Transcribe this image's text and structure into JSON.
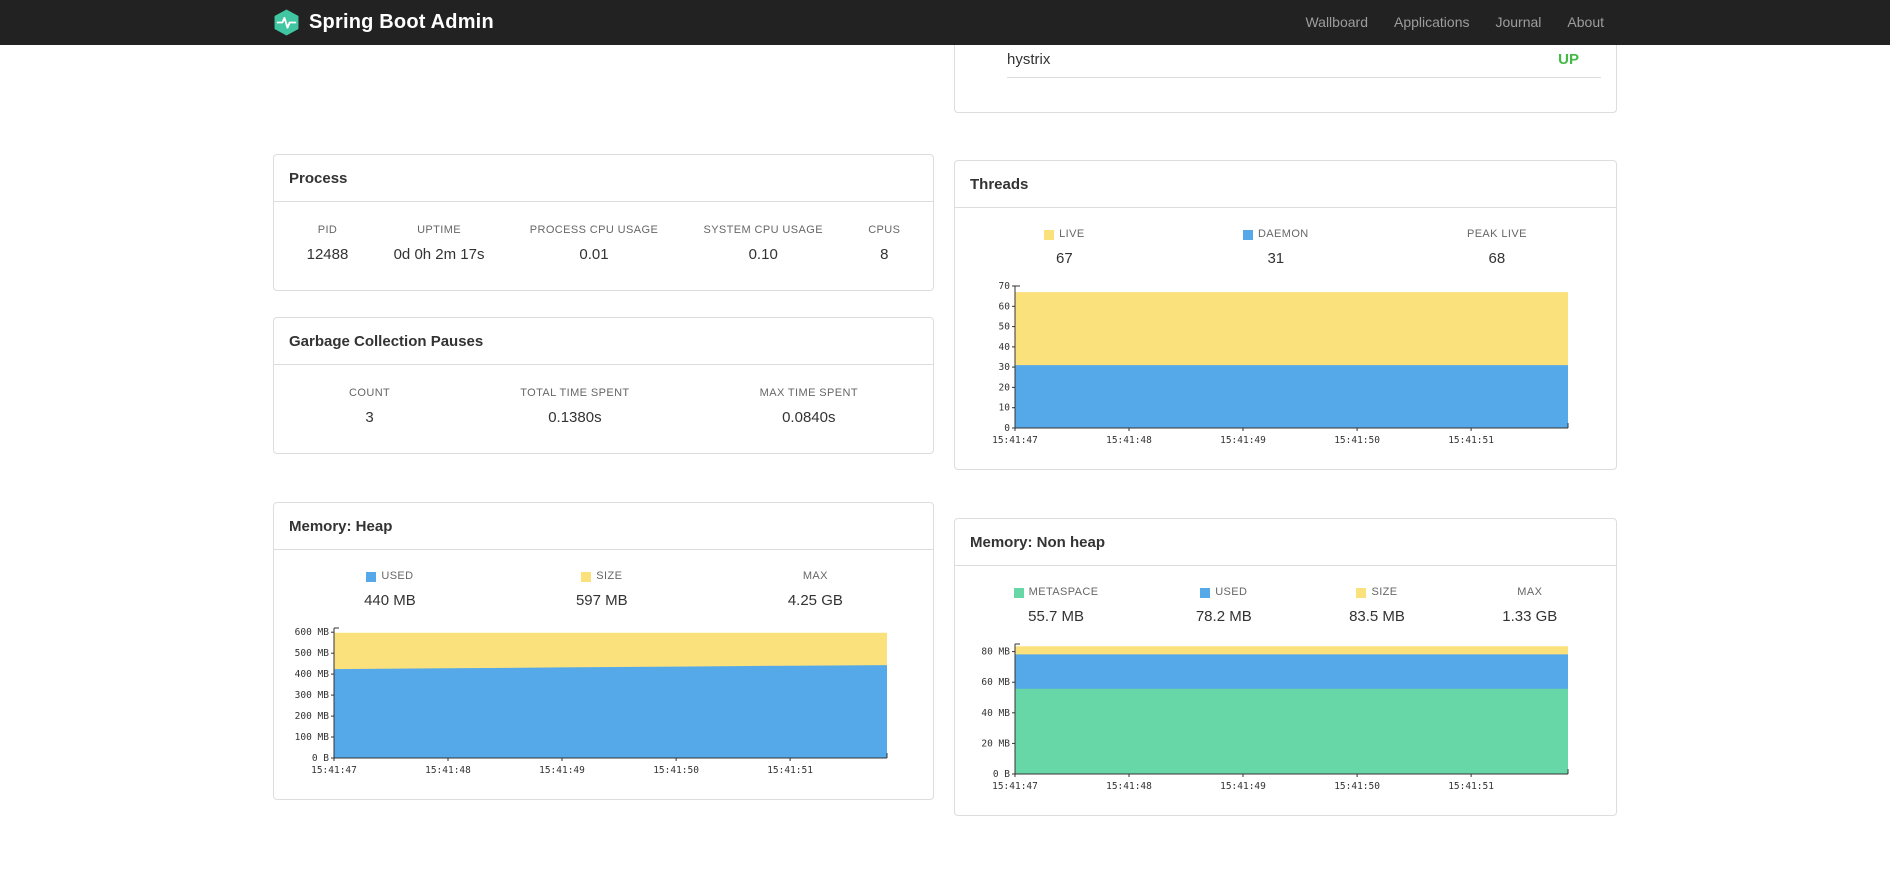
{
  "navbar": {
    "brand": "Spring Boot Admin",
    "links": [
      {
        "label": "Wallboard"
      },
      {
        "label": "Applications"
      },
      {
        "label": "Journal"
      },
      {
        "label": "About"
      }
    ]
  },
  "colors": {
    "navbar_bg": "#222222",
    "logo_green": "#41c6a2",
    "status_up_green": "#45b945",
    "chart_blue": "#56a9e8",
    "chart_yellow": "#fbe17c",
    "chart_green": "#68d7a8",
    "panel_border": "#dddddd"
  },
  "application_status": {
    "name": "hystrix",
    "status": "UP"
  },
  "panels": {
    "process": {
      "title": "Process",
      "metrics": [
        {
          "label": "PID",
          "value": "12488"
        },
        {
          "label": "UPTIME",
          "value": "0d 0h 2m 17s"
        },
        {
          "label": "PROCESS CPU USAGE",
          "value": "0.01"
        },
        {
          "label": "SYSTEM CPU USAGE",
          "value": "0.10"
        },
        {
          "label": "CPUS",
          "value": "8"
        }
      ]
    },
    "gc": {
      "title": "Garbage Collection Pauses",
      "metrics": [
        {
          "label": "COUNT",
          "value": "3"
        },
        {
          "label": "TOTAL TIME SPENT",
          "value": "0.1380s"
        },
        {
          "label": "MAX TIME SPENT",
          "value": "0.0840s"
        }
      ]
    },
    "threads": {
      "title": "Threads",
      "legend": [
        {
          "label": "LIVE",
          "value": "67",
          "color": "#fbe17c"
        },
        {
          "label": "DAEMON",
          "value": "31",
          "color": "#56a9e8"
        },
        {
          "label": "PEAK LIVE",
          "value": "68",
          "color": null
        }
      ]
    },
    "heap": {
      "title": "Memory: Heap",
      "legend": [
        {
          "label": "USED",
          "value": "440 MB",
          "color": "#56a9e8"
        },
        {
          "label": "SIZE",
          "value": "597 MB",
          "color": "#fbe17c"
        },
        {
          "label": "MAX",
          "value": "4.25 GB",
          "color": null
        }
      ]
    },
    "nonheap": {
      "title": "Memory: Non heap",
      "legend": [
        {
          "label": "METASPACE",
          "value": "55.7 MB",
          "color": "#68d7a8"
        },
        {
          "label": "USED",
          "value": "78.2 MB",
          "color": "#56a9e8"
        },
        {
          "label": "SIZE",
          "value": "83.5 MB",
          "color": "#fbe17c"
        },
        {
          "label": "MAX",
          "value": "1.33 GB",
          "color": null
        }
      ]
    }
  },
  "chart_data": [
    {
      "id": "threads",
      "type": "area",
      "stacked": true,
      "title": "Threads",
      "xlabel": "",
      "ylabel": "",
      "x": [
        "15:41:47",
        "15:41:48",
        "15:41:49",
        "15:41:50",
        "15:41:51"
      ],
      "x_overhang": 0.85,
      "ylim": [
        0,
        70
      ],
      "yticks": [
        {
          "v": 0,
          "label": "0"
        },
        {
          "v": 10,
          "label": "10"
        },
        {
          "v": 20,
          "label": "20"
        },
        {
          "v": 30,
          "label": "30"
        },
        {
          "v": 40,
          "label": "40"
        },
        {
          "v": 50,
          "label": "50"
        },
        {
          "v": 60,
          "label": "60"
        },
        {
          "v": 70,
          "label": "70"
        }
      ],
      "series": [
        {
          "name": "LIVE",
          "color": "#fbe17c",
          "values": [
            67,
            67,
            67,
            67,
            67,
            67
          ]
        },
        {
          "name": "DAEMON",
          "color": "#56a9e8",
          "values": [
            31,
            31,
            31,
            31,
            31,
            31
          ]
        }
      ],
      "current": {
        "live": 67,
        "daemon": 31,
        "peak_live": 68
      }
    },
    {
      "id": "memory-heap",
      "type": "area",
      "stacked": true,
      "title": "Memory: Heap",
      "xlabel": "",
      "ylabel": "",
      "x": [
        "15:41:47",
        "15:41:48",
        "15:41:49",
        "15:41:50",
        "15:41:51"
      ],
      "x_overhang": 0.85,
      "ylim": [
        0,
        620
      ],
      "yticks": [
        {
          "v": 0,
          "label": "0 B"
        },
        {
          "v": 100,
          "label": "100 MB"
        },
        {
          "v": 200,
          "label": "200 MB"
        },
        {
          "v": 300,
          "label": "300 MB"
        },
        {
          "v": 400,
          "label": "400 MB"
        },
        {
          "v": 500,
          "label": "500 MB"
        },
        {
          "v": 600,
          "label": "600 MB"
        }
      ],
      "series": [
        {
          "name": "SIZE",
          "color": "#fbe17c",
          "values": [
            597,
            597,
            597,
            597,
            597,
            597
          ]
        },
        {
          "name": "USED",
          "color": "#56a9e8",
          "values": [
            424,
            428,
            432,
            436,
            440,
            443
          ]
        }
      ],
      "current": {
        "used_mb": 440,
        "size_mb": 597,
        "max": "4.25 GB"
      }
    },
    {
      "id": "memory-nonheap",
      "type": "area",
      "stacked": true,
      "title": "Memory: Non heap",
      "xlabel": "",
      "ylabel": "",
      "x": [
        "15:41:47",
        "15:41:48",
        "15:41:49",
        "15:41:50",
        "15:41:51"
      ],
      "x_overhang": 0.85,
      "ylim": [
        0,
        85
      ],
      "yticks": [
        {
          "v": 0,
          "label": "0 B"
        },
        {
          "v": 20,
          "label": "20 MB"
        },
        {
          "v": 40,
          "label": "40 MB"
        },
        {
          "v": 60,
          "label": "60 MB"
        },
        {
          "v": 80,
          "label": "80 MB"
        }
      ],
      "series": [
        {
          "name": "SIZE",
          "color": "#fbe17c",
          "values": [
            83.5,
            83.5,
            83.5,
            83.5,
            83.5,
            83.5
          ]
        },
        {
          "name": "USED",
          "color": "#56a9e8",
          "values": [
            78.2,
            78.2,
            78.2,
            78.2,
            78.2,
            78.2
          ]
        },
        {
          "name": "METASPACE",
          "color": "#68d7a8",
          "values": [
            55.7,
            55.7,
            55.7,
            55.7,
            55.7,
            55.7
          ]
        }
      ],
      "current": {
        "metaspace_mb": 55.7,
        "used_mb": 78.2,
        "size_mb": 83.5,
        "max": "1.33 GB"
      }
    }
  ]
}
